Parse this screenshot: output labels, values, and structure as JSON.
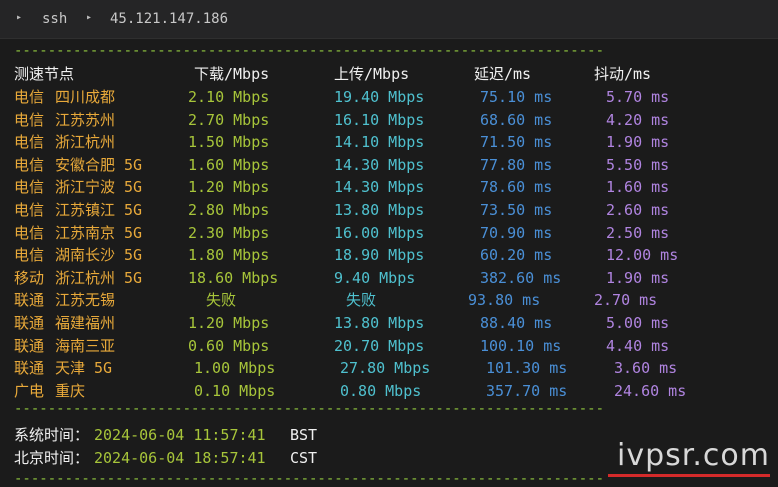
{
  "titlebar": {
    "crumbs": [
      "ssh",
      "45.121.147.186"
    ]
  },
  "separator": "----------------------------------------------------------------------",
  "header": {
    "node": "测速节点",
    "download": "下载/Mbps",
    "upload": "上传/Mbps",
    "latency": "延迟/ms",
    "jitter": "抖动/ms"
  },
  "rows": [
    {
      "isp": "电信",
      "node": "四川成都",
      "download": "2.10 Mbps",
      "upload": "19.40 Mbps",
      "latency": "75.10 ms",
      "jitter": "5.70 ms"
    },
    {
      "isp": "电信",
      "node": "江苏苏州",
      "download": "2.70 Mbps",
      "upload": "16.10 Mbps",
      "latency": "68.60 ms",
      "jitter": "4.20 ms"
    },
    {
      "isp": "电信",
      "node": "浙江杭州",
      "download": "1.50 Mbps",
      "upload": "14.10 Mbps",
      "latency": "71.50 ms",
      "jitter": "1.90 ms"
    },
    {
      "isp": "电信",
      "node": "安徽合肥 5G",
      "download": "1.60 Mbps",
      "upload": "14.30 Mbps",
      "latency": "77.80 ms",
      "jitter": "5.50 ms"
    },
    {
      "isp": "电信",
      "node": "浙江宁波 5G",
      "download": "1.20 Mbps",
      "upload": "14.30 Mbps",
      "latency": "78.60 ms",
      "jitter": "1.60 ms"
    },
    {
      "isp": "电信",
      "node": "江苏镇江 5G",
      "download": "2.80 Mbps",
      "upload": "13.80 Mbps",
      "latency": "73.50 ms",
      "jitter": "2.60 ms"
    },
    {
      "isp": "电信",
      "node": "江苏南京 5G",
      "download": "2.30 Mbps",
      "upload": "16.00 Mbps",
      "latency": "70.90 ms",
      "jitter": "2.50 ms"
    },
    {
      "isp": "电信",
      "node": "湖南长沙 5G",
      "download": "1.80 Mbps",
      "upload": "18.90 Mbps",
      "latency": "60.20 ms",
      "jitter": "12.00 ms"
    },
    {
      "isp": "移动",
      "node": "浙江杭州 5G",
      "download": "18.60 Mbps",
      "upload": "9.40 Mbps",
      "latency": "382.60 ms",
      "jitter": "1.90 ms"
    },
    {
      "isp": "联通",
      "node": "江苏无锡",
      "download": "失败",
      "upload": "失败",
      "latency": "93.80 ms",
      "jitter": "2.70 ms"
    },
    {
      "isp": "联通",
      "node": "福建福州",
      "download": "1.20 Mbps",
      "upload": "13.80 Mbps",
      "latency": "88.40 ms",
      "jitter": "5.00 ms"
    },
    {
      "isp": "联通",
      "node": "海南三亚",
      "download": "0.60 Mbps",
      "upload": "20.70 Mbps",
      "latency": "100.10 ms",
      "jitter": "4.40 ms"
    },
    {
      "isp": "联通",
      "node": "天津 5G",
      "download": "1.00 Mbps",
      "upload": "27.80 Mbps",
      "latency": "101.30 ms",
      "jitter": "3.60 ms"
    },
    {
      "isp": "广电",
      "node": "重庆",
      "download": "0.10 Mbps",
      "upload": "0.80 Mbps",
      "latency": "357.70 ms",
      "jitter": "24.60 ms"
    }
  ],
  "footer": {
    "system_label": "系统时间：",
    "system_time": "2024-06-04 11:57:41",
    "system_tz": "BST",
    "beijing_label": "北京时间：",
    "beijing_time": "2024-06-04 18:57:41",
    "beijing_tz": "CST"
  },
  "watermark": "ivpsr.com",
  "colors": {
    "separator": "#8fc63f",
    "isp": "#e8a93a",
    "download": "#a7c53a",
    "upload": "#4fc1cf",
    "latency": "#4a8fd6",
    "jitter": "#b084e0",
    "watermark_underline": "#d42a2a"
  }
}
